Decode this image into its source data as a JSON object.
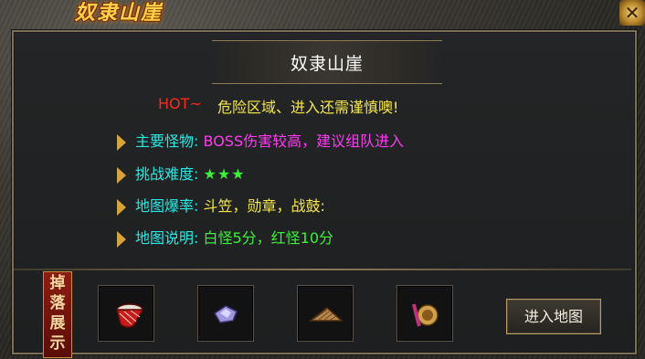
{
  "window": {
    "title": "奴隶山崖",
    "close_symbol": "✕"
  },
  "map": {
    "name": "奴隶山崖",
    "hot_label": "HOT~",
    "hot_message": "危险区域、进入还需谨慎噢!"
  },
  "info_rows": [
    {
      "label": "主要怪物:",
      "value": "BOSS伤害较高，建议组队进入"
    },
    {
      "label": "挑战难度:",
      "value": "★★★"
    },
    {
      "label": "地图爆率:",
      "value": "斗笠，勋章，战鼓:"
    },
    {
      "label": "地图说明:",
      "value": "白怪5分，红怪10分"
    }
  ],
  "drops": {
    "banner_text": "掉落展示",
    "items": [
      {
        "icon": "war-drum-icon"
      },
      {
        "icon": "gem-icon"
      },
      {
        "icon": "bamboo-hat-icon"
      },
      {
        "icon": "medal-icon"
      }
    ]
  },
  "actions": {
    "enter_map_label": "进入地图"
  },
  "colors": {
    "title_gold": "#ffd24a",
    "hot_red": "#ff2a1a",
    "label_cyan": "#28e8e4",
    "value_magenta": "#ff3af2",
    "value_green": "#3cf03a",
    "value_yellow": "#f7e74a"
  }
}
